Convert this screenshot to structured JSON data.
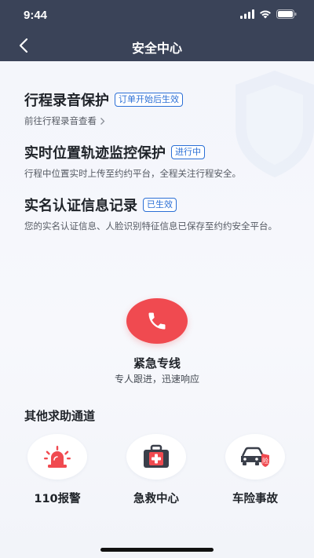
{
  "status_bar": {
    "time": "9:44"
  },
  "nav": {
    "title": "安全中心"
  },
  "features": [
    {
      "title": "行程录音保护",
      "tag": "订单开始后生效",
      "desc": "前往行程录音查看"
    },
    {
      "title": "实时位置轨迹监控保护",
      "tag": "进行中",
      "desc": "行程中位置实时上传至约约平台，全程关注行程安全。"
    },
    {
      "title": "实名认证信息记录",
      "tag": "已生效",
      "desc": "您的实名认证信息、人脸识别特征信息已保存至约约安全平台。"
    }
  ],
  "emergency": {
    "title": "紧急专线",
    "subtitle": "专人跟进，迅速响应"
  },
  "other_channels": {
    "title": "其他求助通道",
    "items": [
      {
        "label": "110报警",
        "icon": "police-alarm-icon"
      },
      {
        "label": "急救中心",
        "icon": "first-aid-kit-icon"
      },
      {
        "label": "车险事故",
        "icon": "car-insurance-icon"
      }
    ]
  },
  "colors": {
    "header": "#3a4358",
    "accent_blue": "#2b6fd6",
    "emergency_red": "#f04a50"
  }
}
